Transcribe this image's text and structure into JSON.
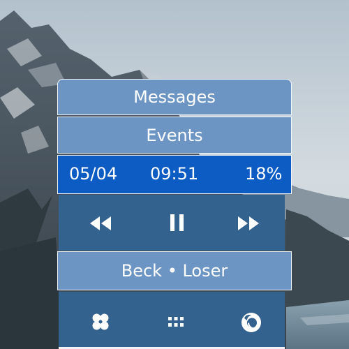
{
  "widget": {
    "buttons": {
      "messages": "Messages",
      "events": "Events"
    },
    "status": {
      "date": "05/04",
      "time": "09:51",
      "battery": "18%"
    },
    "media": {
      "now_playing": "Beck • Loser",
      "controls": [
        "rewind-icon",
        "pause-icon",
        "fast-forward-icon"
      ]
    },
    "dock": {
      "icons": [
        "clover-icon",
        "app-grid-icon",
        "firefox-icon"
      ]
    },
    "colors": {
      "pill": "#6d95c4",
      "status_bar": "#0d5cc4",
      "panel": "#33628f",
      "border": "#f2f5f8",
      "text": "#ffffff"
    }
  }
}
